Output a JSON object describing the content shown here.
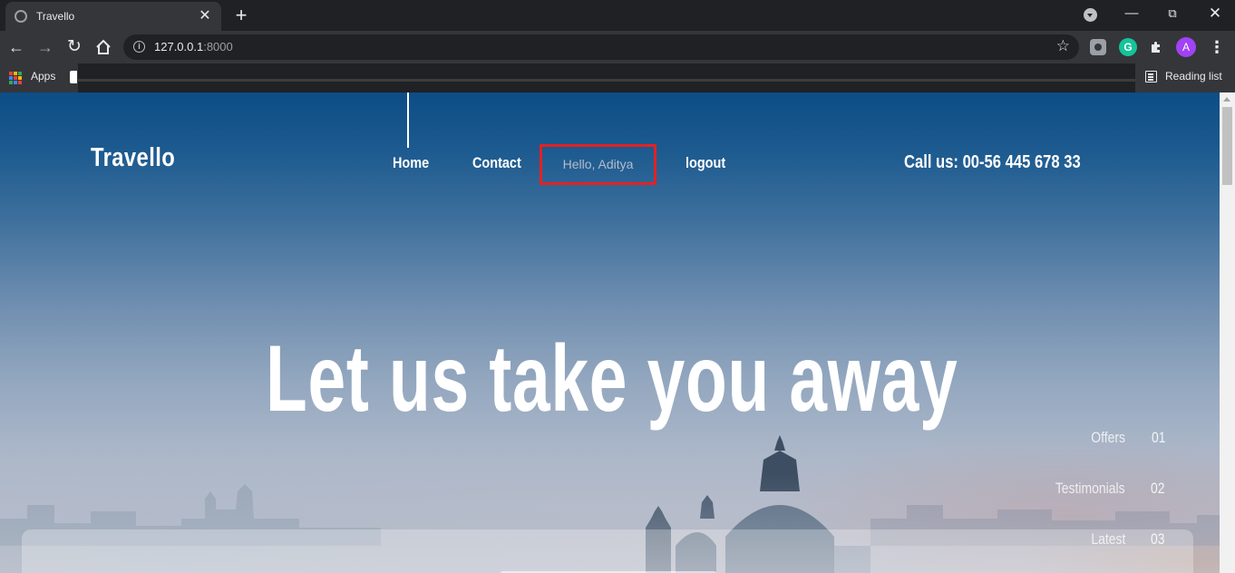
{
  "browser": {
    "tab_title": "Travello",
    "tab_close": "✕",
    "new_tab": "+",
    "url_host": "127.0.0.1",
    "url_port": ":8000",
    "profile_initial": "A",
    "extension_g": "G",
    "bookmarks": {
      "apps_label": "Apps"
    },
    "reading_list_label": "Reading list",
    "icons": [
      "globe-icon",
      "back-icon",
      "forward-icon",
      "reload-icon",
      "home-icon",
      "info-icon",
      "star-icon",
      "puzzle-icon",
      "menu-icon",
      "reading-list-icon"
    ]
  },
  "site": {
    "logo": "Travello",
    "nav": {
      "home": "Home",
      "contact": "Contact",
      "greeting": "Hello, Aditya",
      "logout": "logout"
    },
    "call_us": "Call us: 00-56 445 678 33",
    "hero_title": "Let us take you away",
    "side_nav": [
      {
        "label": "Offers",
        "number": "01"
      },
      {
        "label": "Testimonials",
        "number": "02"
      },
      {
        "label": "Latest",
        "number": "03"
      }
    ],
    "colors": {
      "highlight_border": "#e52121",
      "greeting_text": "#b4bccb",
      "sky_top": "#0d4d86"
    }
  }
}
